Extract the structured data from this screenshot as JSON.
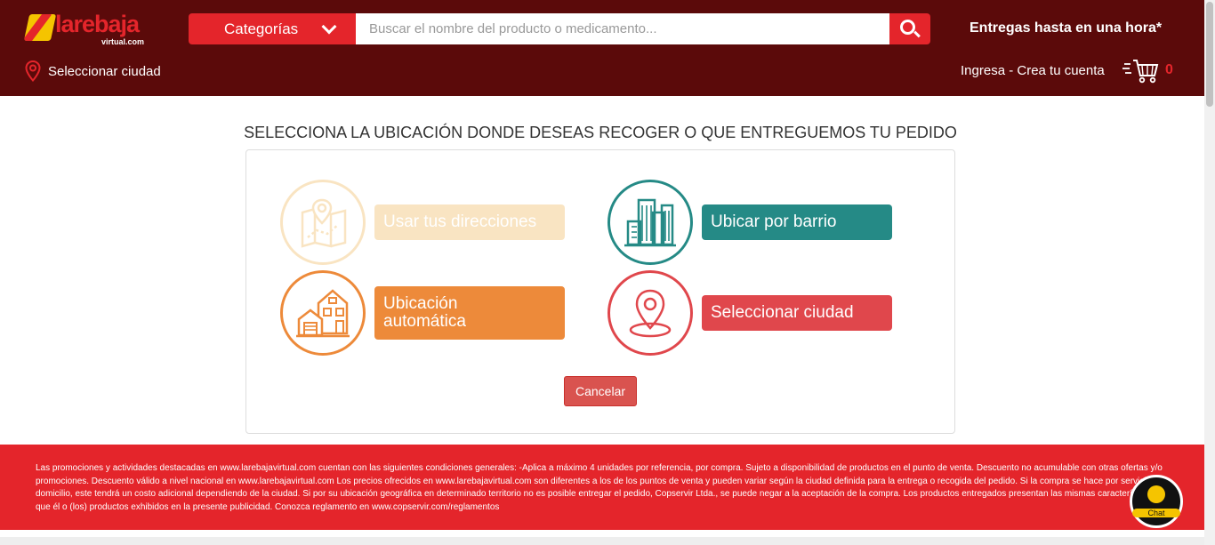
{
  "header": {
    "logo_text": "larebaja",
    "logo_sub": "virtual.com",
    "categories_label": "Categorías",
    "search_placeholder": "Buscar el nombre del producto o medicamento...",
    "delivery_text": "Entregas hasta en una hora*",
    "select_city_label": "Seleccionar ciudad",
    "login_text": "Ingresa - Crea tu cuenta",
    "cart_count": "0"
  },
  "main": {
    "title": "SELECCIONA LA UBICACIÓN DONDE DESEAS RECOGER O QUE ENTREGUEMOS TU PEDIDO",
    "options": [
      {
        "label": "Usar tus direcciones",
        "icon": "map-pin-icon",
        "color": "#f0b552",
        "disabled": true
      },
      {
        "label": "Ubicar por barrio",
        "icon": "city-buildings-icon",
        "color": "#258a86"
      },
      {
        "label_line1": "Ubicación",
        "label_line2": "automática",
        "icon": "houses-icon",
        "color": "#ed8a3a"
      },
      {
        "label": "Seleccionar ciudad",
        "icon": "location-pin-icon",
        "color": "#e0474c"
      }
    ],
    "cancel_label": "Cancelar"
  },
  "footer": {
    "legal_text": "Las promociones y actividades destacadas en www.larebajavirtual.com cuentan con las siguientes condiciones generales: -Aplica a máximo 4 unidades por referencia, por compra. Sujeto a disponibilidad de productos en el punto de venta. Descuento no acumulable con otras ofertas y/o promociones. Descuento válido a nivel nacional en www.larebajavirtual.com Los precios ofrecidos en www.larebajavirtual.com son diferentes a los de los puntos de venta y pueden variar según la ciudad definida para la entrega o recogida del pedido. Si la compra se hace por servicio a domicilio, este tendrá un costo adicional dependiendo de la ciudad. Si por su ubicación geográfica en determinado territorio no es posible entregar el pedido, Copservir Ltda., se puede negar a la aceptación de la compra. Los productos entregados presentan las mismas características que él o (los) productos exhibidos en la presente publicidad. Conozca reglamento en www.copservir.com/reglamentos",
    "chat_label": "Chat"
  },
  "colors": {
    "header_bg": "#5b0a0a",
    "brand_red": "#e4252b",
    "brand_yellow": "#f5c400"
  }
}
